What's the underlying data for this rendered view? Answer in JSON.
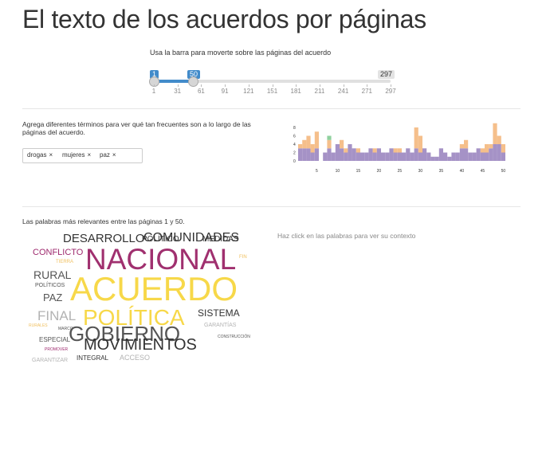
{
  "page": {
    "title": "El texto de los acuerdos por páginas"
  },
  "slider": {
    "instruction": "Usa la barra para moverte sobre las páginas del acuerdo",
    "min": 1,
    "max": 297,
    "from": 1,
    "to": 50,
    "from_label": "1",
    "to_label": "50",
    "max_label": "297",
    "ticks": [
      "1",
      "31",
      "61",
      "91",
      "121",
      "151",
      "181",
      "211",
      "241",
      "271",
      "297"
    ],
    "accent": "#428bca"
  },
  "terms": {
    "instruction": "Agrega diferentes términos para ver qué tan frecuentes son a lo largo de las páginas del acuerdo.",
    "chips": [
      "drogas",
      "mujeres",
      "paz"
    ],
    "remove_glyph": "×"
  },
  "chart_data": {
    "type": "bar",
    "stacked": true,
    "x": [
      1,
      2,
      3,
      4,
      5,
      6,
      7,
      8,
      9,
      10,
      11,
      12,
      13,
      14,
      15,
      16,
      17,
      18,
      19,
      20,
      21,
      22,
      23,
      24,
      25,
      26,
      27,
      28,
      29,
      30,
      31,
      32,
      33,
      34,
      35,
      36,
      37,
      38,
      39,
      40,
      41,
      42,
      43,
      44,
      45,
      46,
      47,
      48,
      49,
      50
    ],
    "series": [
      {
        "color": "#a592c6",
        "values": [
          3,
          3,
          3,
          2,
          3,
          0,
          2,
          3,
          2,
          4,
          3,
          2,
          4,
          3,
          2,
          2,
          2,
          3,
          2,
          3,
          2,
          2,
          3,
          2,
          2,
          2,
          3,
          2,
          3,
          2,
          3,
          2,
          1,
          1,
          3,
          2,
          1,
          2,
          2,
          3,
          3,
          2,
          2,
          3,
          2,
          2,
          3,
          4,
          4,
          2
        ]
      },
      {
        "color": "#f5bf8b",
        "values": [
          1,
          2,
          3,
          2,
          4,
          0,
          0,
          2,
          0,
          0,
          2,
          1,
          0,
          0,
          1,
          0,
          0,
          0,
          1,
          0,
          0,
          0,
          0,
          1,
          1,
          0,
          0,
          0,
          5,
          4,
          0,
          0,
          0,
          0,
          0,
          0,
          0,
          0,
          0,
          1,
          2,
          0,
          0,
          0,
          1,
          2,
          1,
          5,
          2,
          2
        ]
      },
      {
        "color": "#8fd19e",
        "values": [
          0,
          0,
          0,
          0,
          0,
          0,
          0,
          1,
          0,
          0,
          0,
          0,
          0,
          0,
          0,
          0,
          0,
          0,
          0,
          0,
          0,
          0,
          0,
          0,
          0,
          0,
          0,
          0,
          0,
          0,
          0,
          0,
          0,
          0,
          0,
          0,
          0,
          0,
          0,
          0,
          0,
          0,
          0,
          0,
          0,
          0,
          0,
          0,
          0,
          0
        ]
      }
    ],
    "yticks": [
      "0",
      "2",
      "4",
      "6",
      "8"
    ],
    "xticks": [
      "5",
      "10",
      "15",
      "20",
      "25",
      "30",
      "35",
      "40",
      "45",
      "50"
    ],
    "ylim": [
      0,
      8
    ]
  },
  "cloud": {
    "caption": "Las palabras más relevantes entre las páginas 1 y 50.",
    "words": [
      {
        "text": "DESARROLLO",
        "color": "#333333"
      },
      {
        "text": "COMUNIDADES",
        "color": "#333333"
      },
      {
        "text": "POLÍTICO",
        "color": "#333333"
      },
      {
        "text": "MEDIDAS",
        "color": "#333333"
      },
      {
        "text": "CONFLICTO",
        "color": "#9e2a6e"
      },
      {
        "text": "NACIONAL",
        "color": "#a0306f"
      },
      {
        "text": "FIN",
        "color": "#f0c060"
      },
      {
        "text": "TIERRA",
        "color": "#f0c060"
      },
      {
        "text": "RURAL",
        "color": "#555555"
      },
      {
        "text": "POLÍTICOS",
        "color": "#555555"
      },
      {
        "text": "ACUERDO",
        "color": "#f7d849"
      },
      {
        "text": "PAZ",
        "color": "#555555"
      },
      {
        "text": "FINAL",
        "color": "#b3b3b3"
      },
      {
        "text": "POLÍTICA",
        "color": "#f7d849"
      },
      {
        "text": "SISTEMA",
        "color": "#333333"
      },
      {
        "text": "RURALES",
        "color": "#f0c060"
      },
      {
        "text": "MARCO",
        "color": "#555555"
      },
      {
        "text": "GARANTÍAS",
        "color": "#b3b3b3"
      },
      {
        "text": "GOBIERNO",
        "color": "#555555"
      },
      {
        "text": "ESPECIAL",
        "color": "#555555"
      },
      {
        "text": "CONSTRUCCIÓN",
        "color": "#555555"
      },
      {
        "text": "MOVIMIENTOS",
        "color": "#333333"
      },
      {
        "text": "PROMOVER",
        "color": "#9e2a6e"
      },
      {
        "text": "INTEGRAL",
        "color": "#333333"
      },
      {
        "text": "ACCESO",
        "color": "#b3b3b3"
      },
      {
        "text": "GARANTIZAR",
        "color": "#b3b3b3"
      }
    ]
  },
  "context": {
    "hint": "Haz click en las palabras para ver su contexto"
  }
}
